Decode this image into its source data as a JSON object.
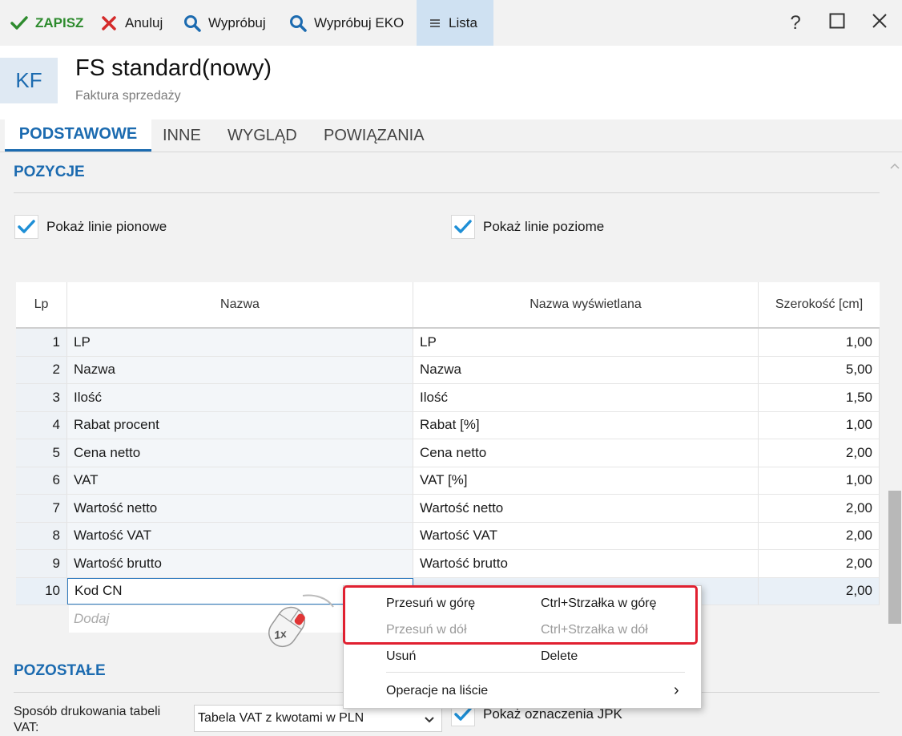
{
  "toolbar": {
    "save_label": "ZAPISZ",
    "cancel_label": "Anuluj",
    "try_label": "Wypróbuj",
    "try_eko_label": "Wypróbuj EKO",
    "list_label": "Lista",
    "help_label": "?",
    "colors": {
      "save": "#2e8b2e",
      "cancel": "#d42a2a",
      "search": "#1c6bb0"
    }
  },
  "header": {
    "badge": "KF",
    "title": "FS standard(nowy)",
    "subtitle": "Faktura sprzedaży"
  },
  "tabs": [
    {
      "label": "PODSTAWOWE",
      "active": true
    },
    {
      "label": "INNE",
      "active": false
    },
    {
      "label": "WYGLĄD",
      "active": false
    },
    {
      "label": "POWIĄZANIA",
      "active": false
    }
  ],
  "pozycje": {
    "title": "POZYCJE",
    "show_vertical_label": "Pokaż linie pionowe",
    "show_vertical": true,
    "show_horizontal_label": "Pokaż linie poziome",
    "show_horizontal": true,
    "columns": [
      "Lp",
      "Nazwa",
      "Nazwa wyświetlana",
      "Szerokość [cm]"
    ],
    "rows": [
      {
        "lp": "1",
        "nazwa": "LP",
        "wys": "LP",
        "szer": "1,00"
      },
      {
        "lp": "2",
        "nazwa": "Nazwa",
        "wys": "Nazwa",
        "szer": "5,00"
      },
      {
        "lp": "3",
        "nazwa": "Ilość",
        "wys": "Ilość",
        "szer": "1,50"
      },
      {
        "lp": "4",
        "nazwa": "Rabat procent",
        "wys": "Rabat [%]",
        "szer": "1,00"
      },
      {
        "lp": "5",
        "nazwa": "Cena netto",
        "wys": "Cena netto",
        "szer": "2,00"
      },
      {
        "lp": "6",
        "nazwa": "VAT",
        "wys": "VAT [%]",
        "szer": "1,00"
      },
      {
        "lp": "7",
        "nazwa": "Wartość netto",
        "wys": "Wartość netto",
        "szer": "2,00"
      },
      {
        "lp": "8",
        "nazwa": "Wartość VAT",
        "wys": "Wartość VAT",
        "szer": "2,00"
      },
      {
        "lp": "9",
        "nazwa": "Wartość brutto",
        "wys": "Wartość brutto",
        "szer": "2,00"
      },
      {
        "lp": "10",
        "nazwa": "Kod CN",
        "wys": "",
        "szer": "2,00"
      }
    ],
    "add_placeholder": "Dodaj"
  },
  "pozostale": {
    "title": "POZOSTAŁE",
    "vat_table_label": "Sposób drukowania tabeli VAT:",
    "vat_table_value": "Tabela VAT z kwotami w PLN",
    "jpk_label": "Pokaż oznaczenia JPK",
    "jpk_checked": true
  },
  "context_menu": {
    "items": [
      {
        "label": "Przesuń w górę",
        "shortcut": "Ctrl+Strzałka w górę",
        "disabled": false
      },
      {
        "label": "Przesuń w dół",
        "shortcut": "Ctrl+Strzałka w dół",
        "disabled": true
      },
      {
        "label": "Usuń",
        "shortcut": "Delete",
        "disabled": false
      },
      {
        "label": "Operacje na liście",
        "shortcut": "›",
        "disabled": false
      }
    ]
  },
  "mouse_hint": {
    "label": "1x"
  }
}
